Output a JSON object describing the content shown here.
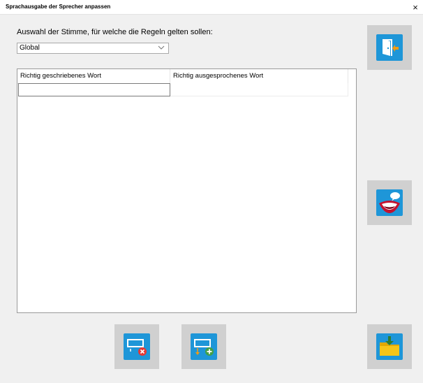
{
  "window": {
    "title": "Sprachausgabe der Sprecher anpassen",
    "close_glyph": "×"
  },
  "voice_selection": {
    "label": "Auswahl der Stimme, für welche die Regeln gelten sollen:",
    "selected_value": "Global"
  },
  "grid": {
    "columns": [
      "Richtig geschriebenes Wort",
      "Richtig ausgesprochenes Wort"
    ],
    "rows": [
      {
        "written": "",
        "pronounced": ""
      }
    ]
  },
  "buttons": {
    "exit": {
      "icon": "exit-door-icon"
    },
    "speak": {
      "icon": "speaking-mouth-icon"
    },
    "delete_row": {
      "icon": "remove-row-icon"
    },
    "add_row": {
      "icon": "add-row-icon"
    },
    "save": {
      "icon": "folder-download-icon"
    }
  },
  "colors": {
    "accent_blue": "#1e96d8",
    "button_bg": "#d0d0d0",
    "delete_red": "#e53935",
    "add_green": "#43a047",
    "folder_yellow": "#f5c518",
    "exit_orange": "#f39c12",
    "mouth_red": "#c4122f"
  }
}
